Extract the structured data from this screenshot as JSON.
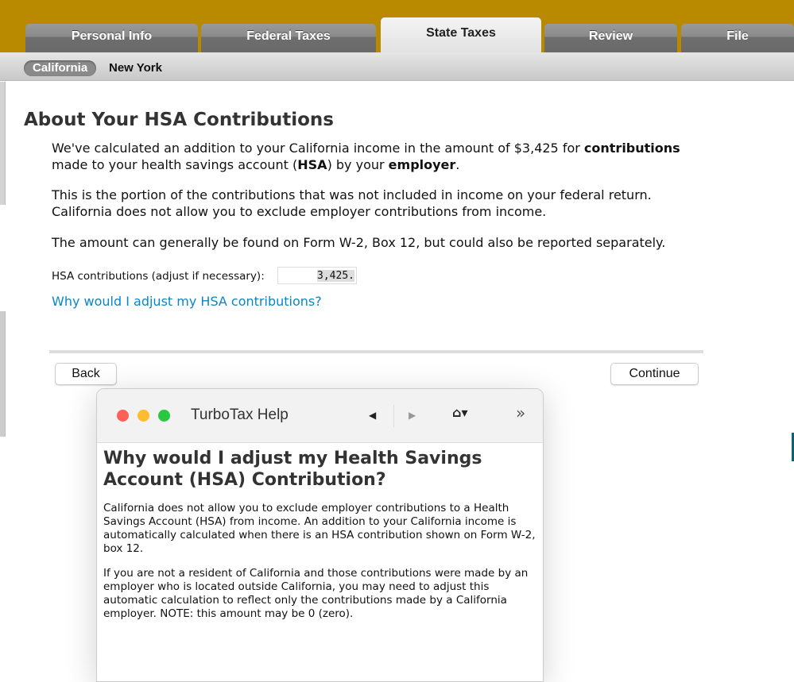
{
  "tabs": [
    {
      "label": "Personal Info"
    },
    {
      "label": "Federal Taxes"
    },
    {
      "label": "State Taxes",
      "active": true
    },
    {
      "label": "Review"
    },
    {
      "label": "File"
    }
  ],
  "states": [
    {
      "label": "California",
      "selected": true
    },
    {
      "label": "New York"
    }
  ],
  "page": {
    "title": "About Your HSA Contributions",
    "para1_a": "We've calculated an addition to your California income in the amount of $3,425 for ",
    "para1_b": "contributions",
    "para1_c": " made to your health savings account (",
    "para1_d": "HSA",
    "para1_e": ") by your ",
    "para1_f": "employer",
    "para1_g": ".",
    "para2": "This is the portion of the contributions that was not included in income on your federal return. California does not allow you to exclude employer contributions from income.",
    "para3": "The amount can generally be found on Form W-2, Box 12, but could also be reported separately.",
    "field_label": "HSA contributions (adjust if necessary):",
    "field_value": "3,425.",
    "link": "Why would I adjust my HSA contributions?",
    "back": "Back",
    "continue": "Continue"
  },
  "help": {
    "window_title": "TurboTax Help",
    "icons": {
      "back": "◀",
      "forward": "▶",
      "home": "⌂▾",
      "more": "»"
    },
    "heading": "Why would I adjust my Health Savings Account (HSA) Contribution?",
    "p1": "California does not allow you to exclude employer contributions to a Health Savings Account (HSA) from income. An addition to your California income is automatically calculated when there is an HSA contribution shown on Form W-2, box 12.",
    "p2": "If you are not a resident of California and those contributions were made by an employer who is located outside California, you may need to adjust this automatic calculation to reflect only the contributions made by a California employer. NOTE: this amount may be 0 (zero)."
  },
  "colors": {
    "header": "#b98a00",
    "link": "#0a86c8"
  }
}
